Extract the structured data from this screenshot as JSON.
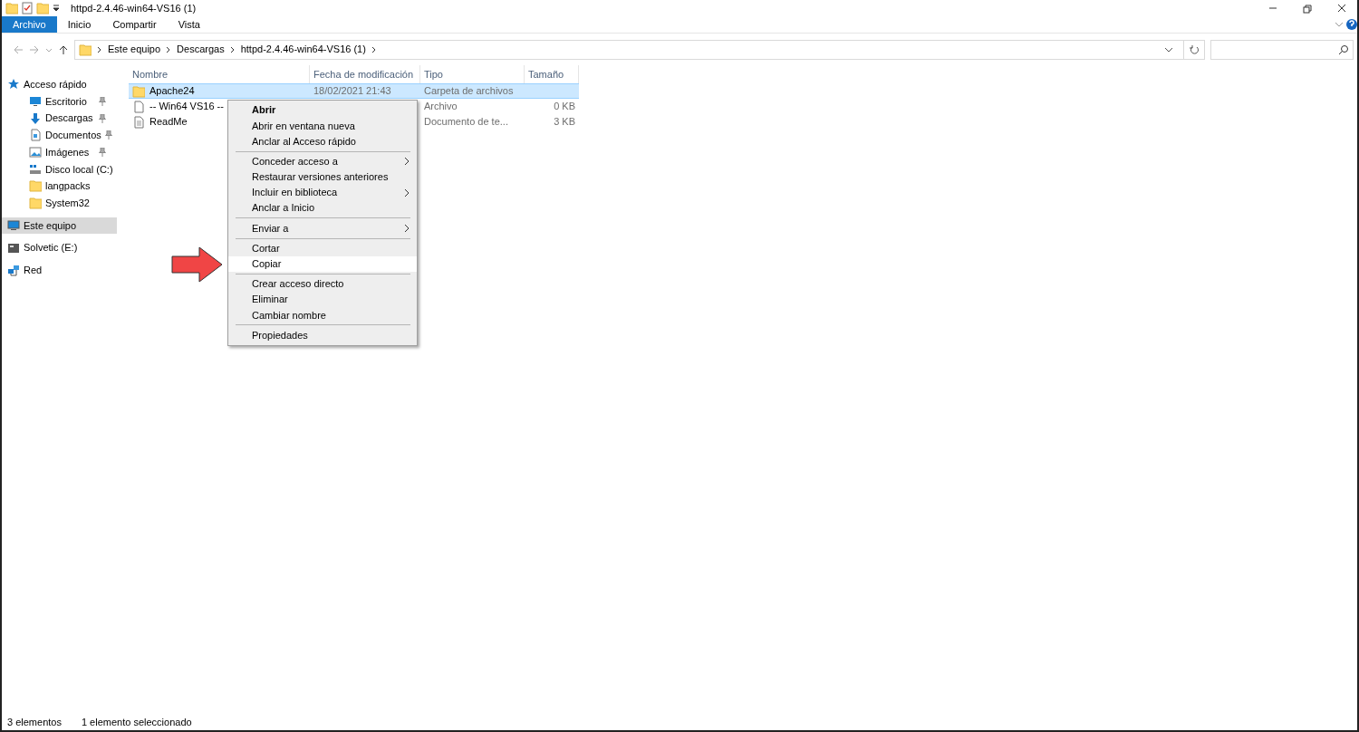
{
  "window": {
    "title": "httpd-2.4.46-win64-VS16 (1)"
  },
  "ribbon_tabs": [
    {
      "label": "Archivo",
      "selected": true,
      "kind": "file"
    },
    {
      "label": "Inicio",
      "selected": false,
      "kind": "tab"
    },
    {
      "label": "Compartir",
      "selected": false,
      "kind": "tab"
    },
    {
      "label": "Vista",
      "selected": false,
      "kind": "tab"
    }
  ],
  "breadcrumb": [
    "Este equipo",
    "Descargas",
    "httpd-2.4.46-win64-VS16 (1)"
  ],
  "sidebar": {
    "items": [
      {
        "label": "Acceso rápido",
        "kind": "star",
        "pinned": false,
        "selected": false,
        "children": [
          {
            "label": "Escritorio",
            "kind": "desktop",
            "pinned": true,
            "selected": false
          },
          {
            "label": "Descargas",
            "kind": "download",
            "pinned": true,
            "selected": false
          },
          {
            "label": "Documentos",
            "kind": "document",
            "pinned": true,
            "selected": false
          },
          {
            "label": "Imágenes",
            "kind": "image",
            "pinned": true,
            "selected": false
          },
          {
            "label": "Disco local (C:)",
            "kind": "drive",
            "pinned": false,
            "selected": false
          },
          {
            "label": "langpacks",
            "kind": "folder",
            "pinned": false,
            "selected": false
          },
          {
            "label": "System32",
            "kind": "folder",
            "pinned": false,
            "selected": false
          }
        ]
      },
      {
        "label": "Este equipo",
        "kind": "pc",
        "pinned": false,
        "selected": true
      },
      {
        "label": "Solvetic (E:)",
        "kind": "usb",
        "pinned": false,
        "selected": false
      },
      {
        "label": "Red",
        "kind": "network",
        "pinned": false,
        "selected": false
      }
    ]
  },
  "table": {
    "columns": [
      "Nombre",
      "Fecha de modificación",
      "Tipo",
      "Tamaño"
    ],
    "rows": [
      {
        "kind": "folder",
        "name": "Apache24",
        "date": "18/02/2021 21:43",
        "type": "Carpeta de archivos",
        "selected": true
      },
      {
        "kind": "file",
        "name": "-- Win64 VS16 --",
        "type": "Archivo",
        "size": "0 KB",
        "selected": false
      },
      {
        "kind": "text",
        "name": "ReadMe",
        "type": "Documento de te...",
        "size": "3 KB",
        "selected": false
      }
    ]
  },
  "context_menu": [
    {
      "kind": "item",
      "label": "Abrir",
      "bold": true,
      "submenu": false,
      "selected": false
    },
    {
      "kind": "item",
      "label": "Abrir en ventana nueva",
      "bold": false,
      "submenu": false,
      "selected": false
    },
    {
      "kind": "item",
      "label": "Anclar al Acceso rápido",
      "bold": false,
      "submenu": false,
      "selected": false
    },
    {
      "kind": "separator"
    },
    {
      "kind": "item",
      "label": "Conceder acceso a",
      "bold": false,
      "submenu": true,
      "selected": false
    },
    {
      "kind": "item",
      "label": "Restaurar versiones anteriores",
      "bold": false,
      "submenu": false,
      "selected": false
    },
    {
      "kind": "item",
      "label": "Incluir en biblioteca",
      "bold": false,
      "submenu": true,
      "selected": false
    },
    {
      "kind": "item",
      "label": "Anclar a Inicio",
      "bold": false,
      "submenu": false,
      "selected": false
    },
    {
      "kind": "separator"
    },
    {
      "kind": "item",
      "label": "Enviar a",
      "bold": false,
      "submenu": true,
      "selected": false
    },
    {
      "kind": "separator"
    },
    {
      "kind": "item",
      "label": "Cortar",
      "bold": false,
      "submenu": false,
      "selected": false
    },
    {
      "kind": "item",
      "label": "Copiar",
      "bold": false,
      "submenu": false,
      "selected": true
    },
    {
      "kind": "separator"
    },
    {
      "kind": "item",
      "label": "Crear acceso directo",
      "bold": false,
      "submenu": false,
      "selected": false
    },
    {
      "kind": "item",
      "label": "Eliminar",
      "bold": false,
      "submenu": false,
      "selected": false
    },
    {
      "kind": "item",
      "label": "Cambiar nombre",
      "bold": false,
      "submenu": false,
      "selected": false
    },
    {
      "kind": "separator"
    },
    {
      "kind": "item",
      "label": "Propiedades",
      "bold": false,
      "submenu": false,
      "selected": false
    }
  ],
  "status_bar": [
    "3 elementos",
    "1 elemento seleccionado"
  ]
}
